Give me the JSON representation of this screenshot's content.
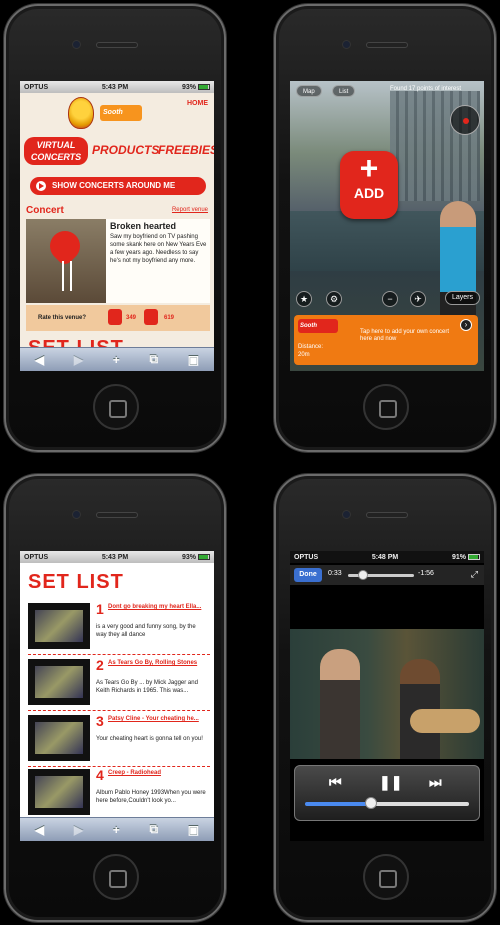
{
  "phone1": {
    "status": {
      "carrier": "OPTUS",
      "time": "5:43 PM",
      "battery": "93%"
    },
    "home_link": "HOME",
    "brand": "Sooth",
    "nav": {
      "virtual_concerts": "VIRTUAL CONCERTS",
      "products": "PRODUCTS",
      "freebies": "FREEBIES"
    },
    "show_button": "SHOW CONCERTS AROUND ME",
    "concert_heading": "Concert",
    "report_link": "Report venue",
    "venue": {
      "title": "Broken hearted",
      "text": "Saw my boyfriend on TV pashing some skank here on New Years Eve a few years ago. Needless to say he's not my boyfriend any more."
    },
    "rating": {
      "label": "Rate this venue?",
      "up_count": "349",
      "down_count": "619"
    },
    "set_list_peek": "SET LIST",
    "safari": {
      "back": "◀",
      "forward": "▶",
      "add": "+",
      "bookmarks": "⧉",
      "pages": "▣"
    }
  },
  "phone2": {
    "tabs": {
      "map": "Map",
      "list": "List"
    },
    "found_text": "Found 17 points of interest",
    "add_label": "ADD",
    "layers": "Layers",
    "poi": {
      "badge": "Sooth",
      "distance_label": "Distance:",
      "distance_value": "20m",
      "text": "Tap here to add your own concert here and now"
    }
  },
  "phone3": {
    "status": {
      "carrier": "OPTUS",
      "time": "5:43 PM",
      "battery": "93%"
    },
    "heading": "SET LIST",
    "songs": [
      {
        "num": "1",
        "title": "Dont go breaking my heart Ella...",
        "desc": "is a very good and funny song, by the way they all dance"
      },
      {
        "num": "2",
        "title": "As Tears Go By, Rolling Stones",
        "desc": "As Tears Go By ... by Mick Jagger and Keith Richards in 1965. This was..."
      },
      {
        "num": "3",
        "title": "Patsy Cline - Your cheating he...",
        "desc": "Your cheating heart is gonna tell on you!"
      },
      {
        "num": "4",
        "title": "Creep - Radiohead",
        "desc": "Album Pablo Honey 1993When you were here before,Couldn't look yo..."
      }
    ]
  },
  "phone4": {
    "status": {
      "carrier": "OPTUS",
      "time": "5:48 PM",
      "battery": "91%"
    },
    "done": "Done",
    "elapsed": "0:33",
    "remaining": "-1:56",
    "playback_progress": 0.22,
    "volume_level": 0.4
  }
}
